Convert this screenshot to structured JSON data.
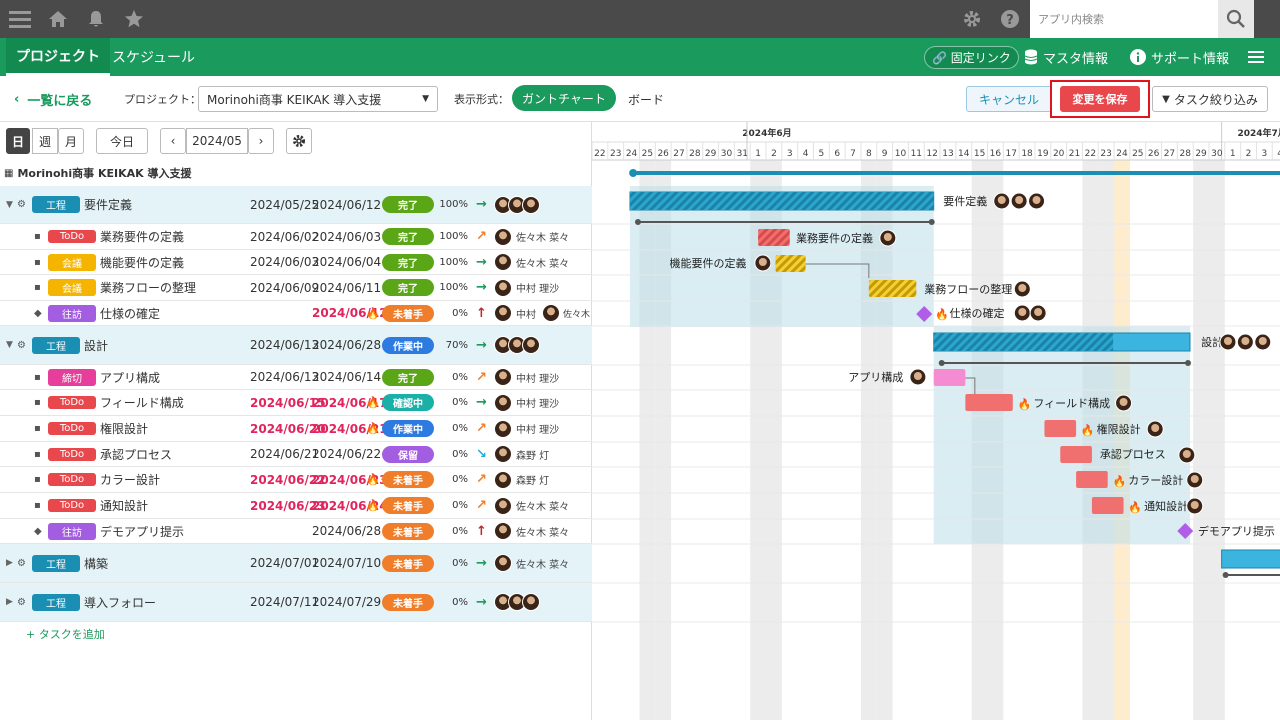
{
  "topbar": {
    "search_placeholder": "アプリ内検索"
  },
  "nav": {
    "tabs": [
      "プロジェクト",
      "スケジュール"
    ],
    "fixed_link": "固定リンク",
    "master": "マスタ情報",
    "support": "サポート情報"
  },
  "toolbar": {
    "back": "一覧に戻る",
    "project_label": "プロジェクト：",
    "project_value": "Morinohi商事 KEIKAK 導入支援",
    "display_label": "表示形式：",
    "gantt": "ガントチャート",
    "board": "ボード",
    "cancel": "キャンセル",
    "save": "変更を保存",
    "filter": "タスク絞り込み"
  },
  "controls": {
    "day": "日",
    "week": "週",
    "month": "月",
    "today": "今日",
    "period": "2024/05",
    "prev": "‹",
    "next": "›"
  },
  "project_title": "Morinohi商事 KEIKAK 導入支援",
  "add_task": "+ タスクを追加",
  "tasks": [
    {
      "tag": "工程",
      "tagColor": "#1b8fb3",
      "name": "要件定義",
      "start": "2024/05/25",
      "end": "2024/06/12",
      "status": "完了",
      "statusColor": "#5aa617",
      "pct": "100%",
      "arrow": "→",
      "arrowColor": "#1a9a5c",
      "assignee": "",
      "parent": true
    },
    {
      "tag": "ToDo",
      "tagColor": "#e8474c",
      "name": "業務要件の定義",
      "start": "2024/06/02",
      "end": "2024/06/03",
      "status": "完了",
      "statusColor": "#5aa617",
      "pct": "100%",
      "arrow": "↗",
      "arrowColor": "#f07d2a",
      "assignee": "佐々木 菜々"
    },
    {
      "tag": "会議",
      "tagColor": "#f5b400",
      "name": "機能要件の定義",
      "start": "2024/06/03",
      "end": "2024/06/04",
      "status": "完了",
      "statusColor": "#5aa617",
      "pct": "100%",
      "arrow": "→",
      "arrowColor": "#1a9a5c",
      "assignee": "佐々木 菜々"
    },
    {
      "tag": "会議",
      "tagColor": "#f5b400",
      "name": "業務フローの整理",
      "start": "2024/06/09",
      "end": "2024/06/11",
      "status": "完了",
      "statusColor": "#5aa617",
      "pct": "100%",
      "arrow": "→",
      "arrowColor": "#1a9a5c",
      "assignee": "中村 理沙"
    },
    {
      "tag": "往訪",
      "tagColor": "#a25de0",
      "name": "仕様の確定",
      "start": "",
      "end": "2024/06/12",
      "endRed": true,
      "fire": true,
      "status": "未着手",
      "statusColor": "#f07d2a",
      "pct": "0%",
      "arrow": "↑",
      "arrowColor": "#c0282d",
      "assignee": "中村",
      "assignee2": "佐々木",
      "diamond": true
    },
    {
      "tag": "工程",
      "tagColor": "#1b8fb3",
      "name": "設計",
      "start": "2024/06/13",
      "end": "2024/06/28",
      "status": "作業中",
      "statusColor": "#2d7be0",
      "pct": "70%",
      "arrow": "→",
      "arrowColor": "#1a9a5c",
      "assignee": "",
      "parent": true
    },
    {
      "tag": "締切",
      "tagColor": "#e83e9b",
      "name": "アプリ構成",
      "start": "2024/06/13",
      "end": "2024/06/14",
      "status": "完了",
      "statusColor": "#5aa617",
      "pct": "0%",
      "arrow": "↗",
      "arrowColor": "#f07d2a",
      "assignee": "中村 理沙"
    },
    {
      "tag": "ToDo",
      "tagColor": "#e8474c",
      "name": "フィールド構成",
      "start": "2024/06/15",
      "end": "2024/06/17",
      "startRed": true,
      "endRed": true,
      "fire": true,
      "status": "確認中",
      "statusColor": "#1ab0a8",
      "pct": "0%",
      "arrow": "→",
      "arrowColor": "#1a9a5c",
      "assignee": "中村 理沙"
    },
    {
      "tag": "ToDo",
      "tagColor": "#e8474c",
      "name": "権限設計",
      "start": "2024/06/20",
      "end": "2024/06/21",
      "startRed": true,
      "endRed": true,
      "fire": true,
      "status": "作業中",
      "statusColor": "#2d7be0",
      "pct": "0%",
      "arrow": "↗",
      "arrowColor": "#f07d2a",
      "assignee": "中村 理沙"
    },
    {
      "tag": "ToDo",
      "tagColor": "#e8474c",
      "name": "承認プロセス",
      "start": "2024/06/21",
      "end": "2024/06/22",
      "status": "保留",
      "statusColor": "#a25de0",
      "pct": "0%",
      "arrow": "↘",
      "arrowColor": "#1ab0d8",
      "assignee": "森野 灯"
    },
    {
      "tag": "ToDo",
      "tagColor": "#e8474c",
      "name": "カラー設計",
      "start": "2024/06/22",
      "end": "2024/06/23",
      "startRed": true,
      "endRed": true,
      "fire": true,
      "status": "未着手",
      "statusColor": "#f07d2a",
      "pct": "0%",
      "arrow": "↗",
      "arrowColor": "#f07d2a",
      "assignee": "森野 灯"
    },
    {
      "tag": "ToDo",
      "tagColor": "#e8474c",
      "name": "通知設計",
      "start": "2024/06/23",
      "end": "2024/06/24",
      "startRed": true,
      "endRed": true,
      "fire": true,
      "status": "未着手",
      "statusColor": "#f07d2a",
      "pct": "0%",
      "arrow": "↗",
      "arrowColor": "#f07d2a",
      "assignee": "佐々木 菜々"
    },
    {
      "tag": "往訪",
      "tagColor": "#a25de0",
      "name": "デモアプリ提示",
      "start": "",
      "end": "2024/06/28",
      "status": "未着手",
      "statusColor": "#f07d2a",
      "pct": "0%",
      "arrow": "↑",
      "arrowColor": "#c0282d",
      "assignee": "佐々木 菜々",
      "diamond": true
    },
    {
      "tag": "工程",
      "tagColor": "#1b8fb3",
      "name": "構築",
      "start": "2024/07/01",
      "end": "2024/07/10",
      "status": "未着手",
      "statusColor": "#f07d2a",
      "pct": "0%",
      "arrow": "→",
      "arrowColor": "#1a9a5c",
      "assignee": "佐々木 菜々",
      "parent": true,
      "collapsed": true
    },
    {
      "tag": "工程",
      "tagColor": "#1b8fb3",
      "name": "導入フォロー",
      "start": "2024/07/11",
      "end": "2024/07/29",
      "status": "未着手",
      "statusColor": "#f07d2a",
      "pct": "0%",
      "arrow": "→",
      "arrowColor": "#1a9a5c",
      "assignee": "",
      "parent": true,
      "collapsed": true
    }
  ],
  "gantt": {
    "month_labels": [
      "2024年6月",
      "2024年7月"
    ],
    "days": [
      22,
      23,
      24,
      25,
      26,
      27,
      28,
      29,
      30,
      31,
      1,
      2,
      3,
      4,
      5,
      6,
      7,
      8,
      9,
      10,
      11,
      12,
      13,
      14,
      15,
      16,
      17,
      18,
      19,
      20,
      21,
      22,
      23,
      24,
      25,
      26,
      27,
      28,
      29,
      30,
      1,
      2,
      3,
      4
    ]
  }
}
